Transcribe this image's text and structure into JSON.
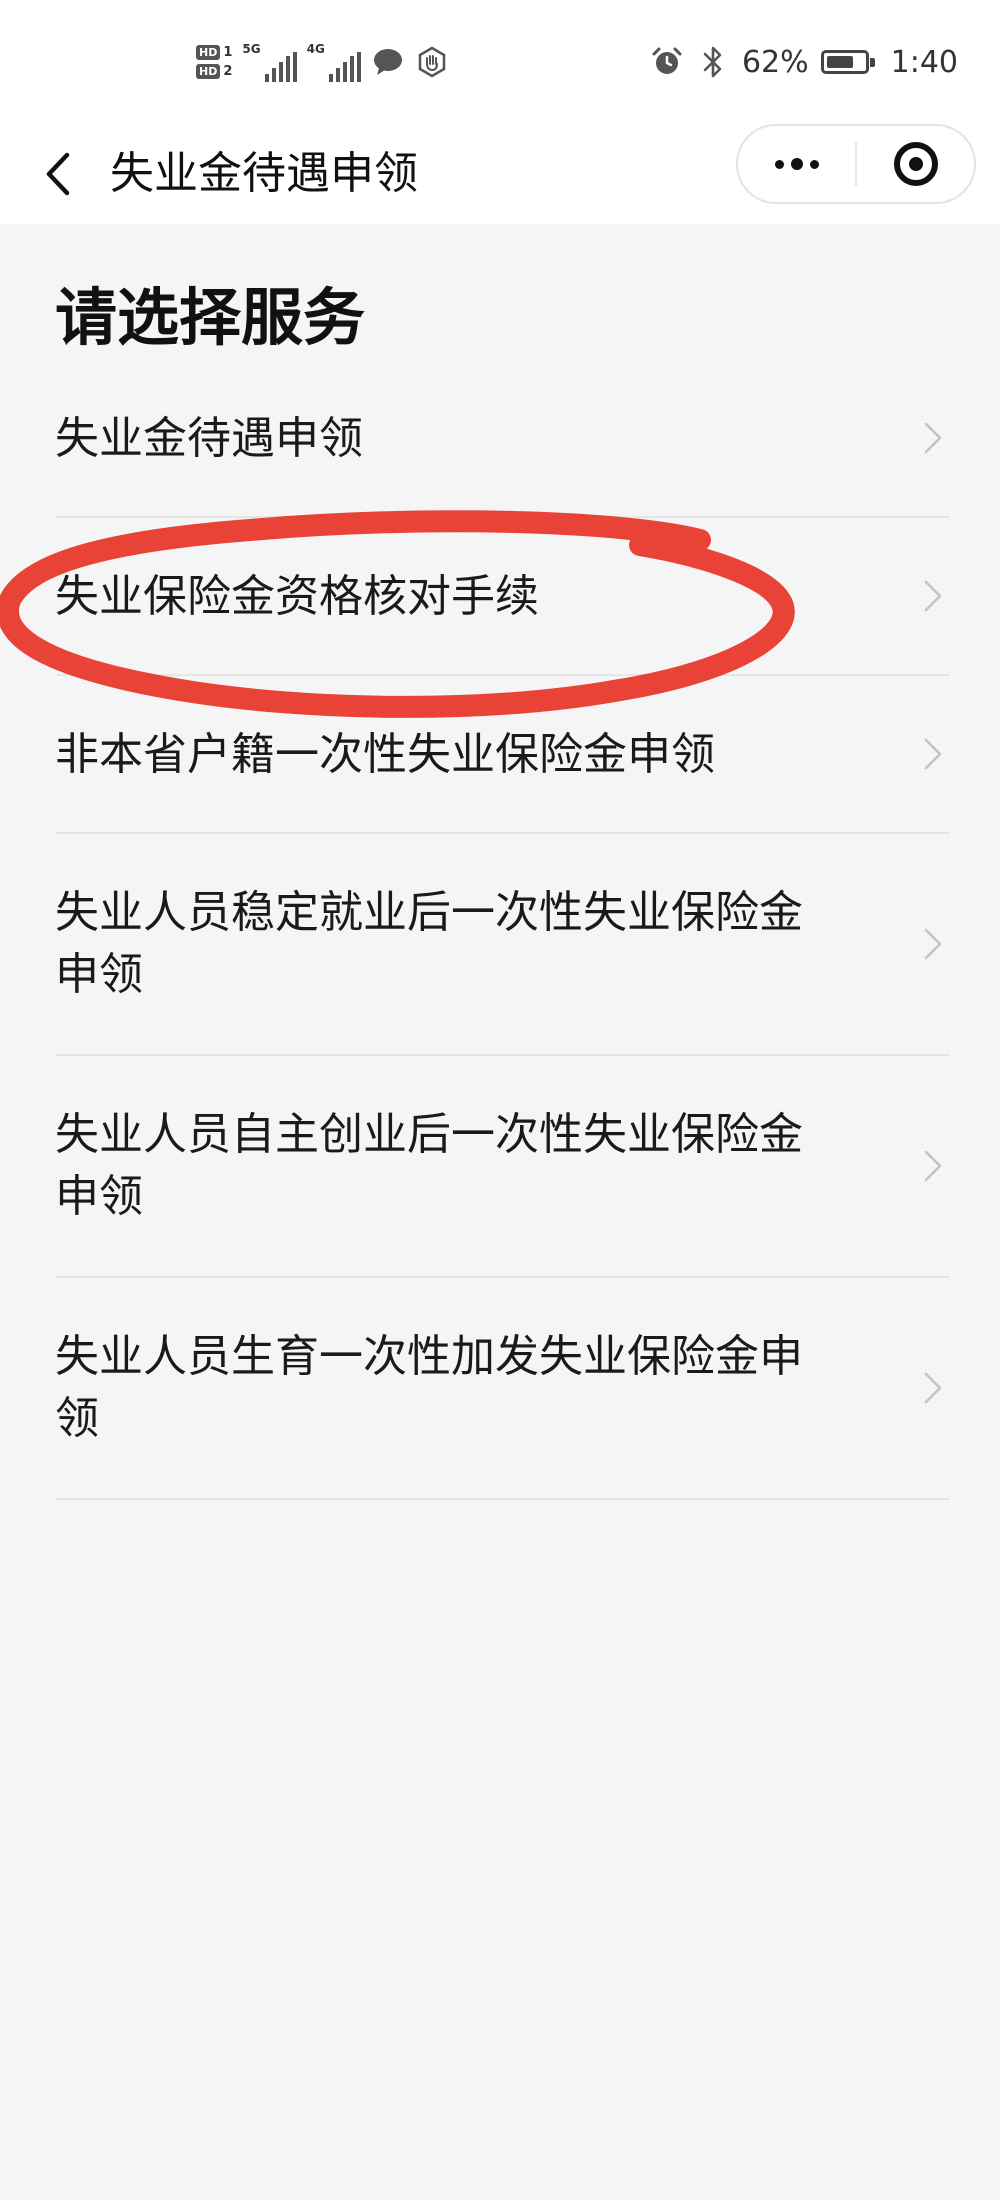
{
  "status_bar": {
    "hd1_label": "HD",
    "hd1_num": "1",
    "hd2_label": "HD",
    "hd2_num": "2",
    "net1": "5G",
    "net2": "4G",
    "battery_percent": "62%",
    "time": "1:40",
    "icons": [
      "wechat-chat-icon",
      "hand-icon",
      "alarm-icon",
      "bluetooth-icon",
      "battery-icon"
    ]
  },
  "navbar": {
    "title": "失业金待遇申领",
    "back_icon": "chevron-left-icon",
    "more_icon": "more-dots-icon",
    "close_icon": "target-circle-icon"
  },
  "page": {
    "section_title": "请选择服务",
    "items": [
      {
        "label": "失业金待遇申领"
      },
      {
        "label": "失业保险金资格核对手续"
      },
      {
        "label": "非本省户籍一次性失业保险金申领"
      },
      {
        "label": "失业人员稳定就业后一次性失业保险金申领"
      },
      {
        "label": "失业人员自主创业后一次性失业保险金申领"
      },
      {
        "label": "失业人员生育一次性加发失业保险金申领"
      }
    ]
  },
  "colors": {
    "background": "#f5f5f5",
    "header": "#ffffff",
    "text": "#111111",
    "divider": "#e6e6e6",
    "chevron": "#c4c4c4",
    "annotation": "#e8392c"
  }
}
